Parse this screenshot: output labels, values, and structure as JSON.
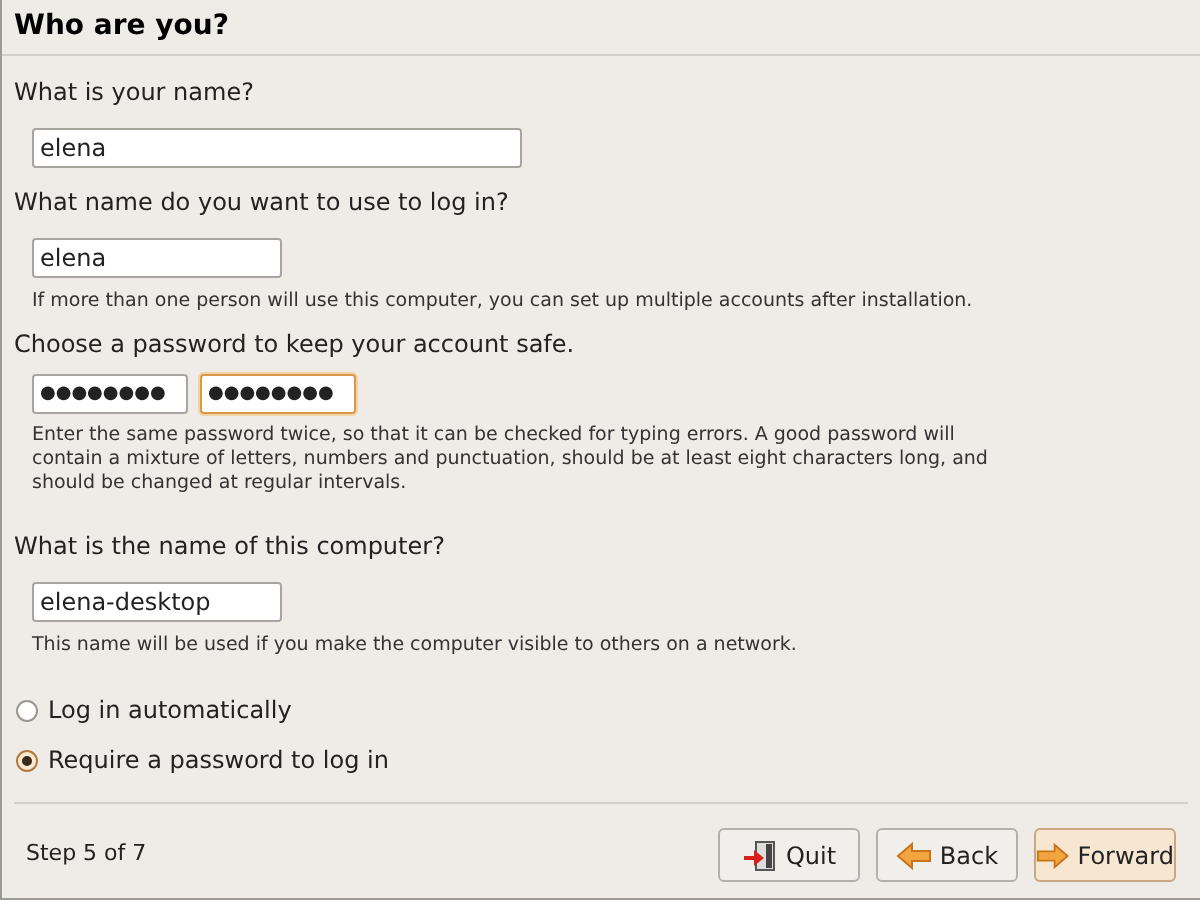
{
  "title": "Who are you?",
  "name": {
    "label": "What is your name?",
    "value": "elena"
  },
  "login": {
    "label": "What name do you want to use to log in?",
    "value": "elena",
    "hint": "If more than one person will use this computer, you can set up multiple accounts after installation."
  },
  "password": {
    "label": "Choose a password to keep your account safe.",
    "fields": [
      {
        "value": "●●●●●●●●",
        "focused": false
      },
      {
        "value": "●●●●●●●●",
        "focused": true
      }
    ],
    "hint": "Enter the same password twice, so that it can be checked for typing errors. A good password will contain a mixture of letters, numbers and punctuation, should be at least eight characters long, and should be changed at regular intervals."
  },
  "computer": {
    "label": "What is the name of this computer?",
    "value": "elena-desktop",
    "hint": "This name will be used if you make the computer visible to others on a network."
  },
  "login_options": [
    {
      "label": "Log in automatically",
      "selected": false
    },
    {
      "label": "Require a password to log in",
      "selected": true
    }
  ],
  "step": "Step 5 of 7",
  "buttons": [
    {
      "kind": "quit",
      "label": "Quit",
      "default": false
    },
    {
      "kind": "back",
      "label": "Back",
      "default": false
    },
    {
      "kind": "forward",
      "label": "Forward",
      "default": true
    }
  ]
}
